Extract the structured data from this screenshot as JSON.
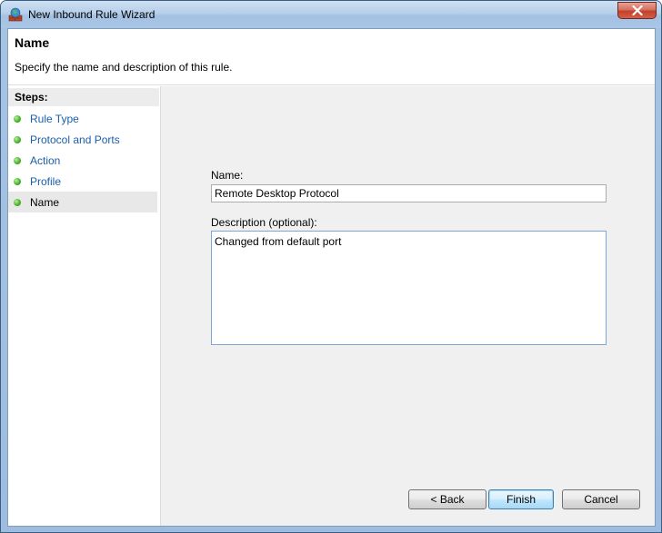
{
  "window": {
    "title": "New Inbound Rule Wizard"
  },
  "header": {
    "title": "Name",
    "subtitle": "Specify the name and description of this rule."
  },
  "steps": {
    "heading": "Steps:",
    "items": [
      {
        "label": "Rule Type"
      },
      {
        "label": "Protocol and Ports"
      },
      {
        "label": "Action"
      },
      {
        "label": "Profile"
      },
      {
        "label": "Name"
      }
    ],
    "current_index": 4
  },
  "form": {
    "name_label": "Name:",
    "name_value": "Remote Desktop Protocol",
    "description_label": "Description (optional):",
    "description_value": "Changed from default port"
  },
  "buttons": {
    "back": "< Back",
    "finish": "Finish",
    "cancel": "Cancel"
  },
  "colors": {
    "link": "#1a5eab",
    "step_dot": "#4bb52c",
    "close_button": "#c43f2a"
  }
}
